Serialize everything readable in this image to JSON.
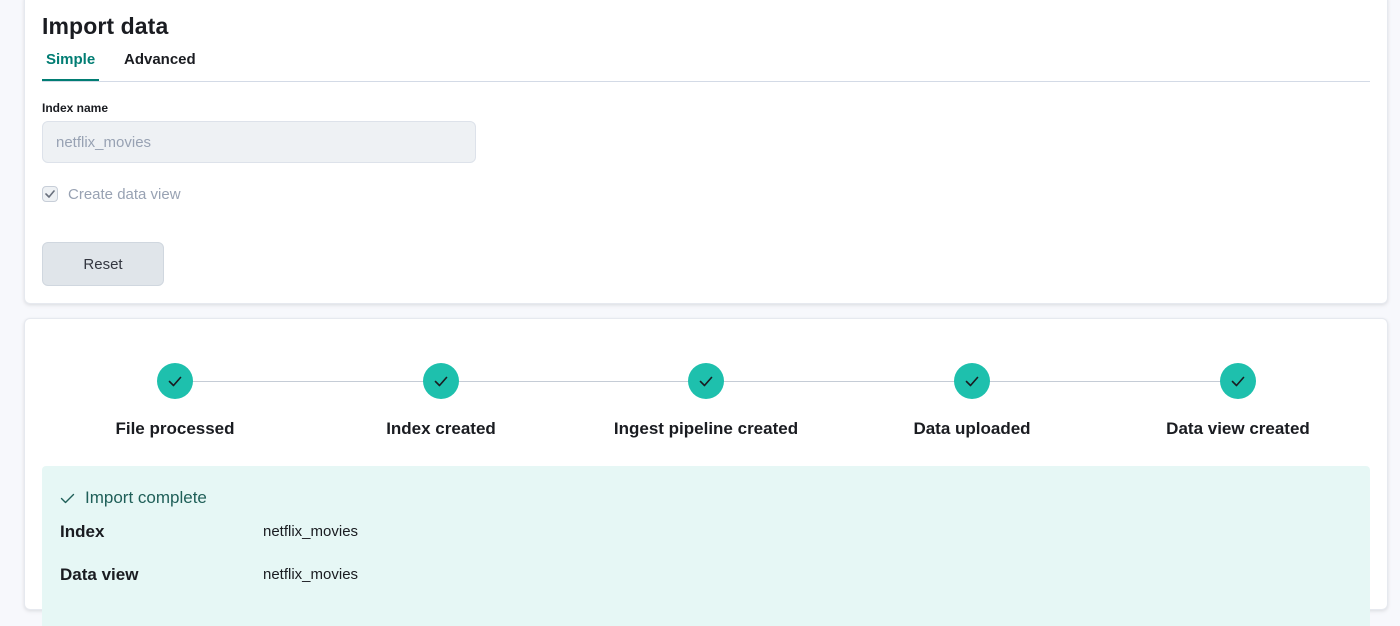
{
  "page": {
    "title": "Import data"
  },
  "tabs": [
    {
      "label": "Simple",
      "selected": true
    },
    {
      "label": "Advanced",
      "selected": false
    }
  ],
  "form": {
    "index_name_label": "Index name",
    "index_name_value": "netflix_movies",
    "create_data_view_label": "Create data view",
    "create_data_view_checked": true,
    "reset_label": "Reset"
  },
  "steps": [
    {
      "label": "File processed",
      "icon": "check-icon"
    },
    {
      "label": "Index created",
      "icon": "check-icon"
    },
    {
      "label": "Ingest pipeline created",
      "icon": "check-icon"
    },
    {
      "label": "Data uploaded",
      "icon": "check-icon"
    },
    {
      "label": "Data view created",
      "icon": "check-icon"
    }
  ],
  "result": {
    "title": "Import complete",
    "rows": [
      {
        "key": "Index",
        "value": "netflix_movies"
      },
      {
        "key": "Data view",
        "value": "netflix_movies"
      }
    ]
  },
  "colors": {
    "accent": "#017d73",
    "step_complete": "#1ec0ad",
    "callout_bg": "#e6f7f5"
  }
}
